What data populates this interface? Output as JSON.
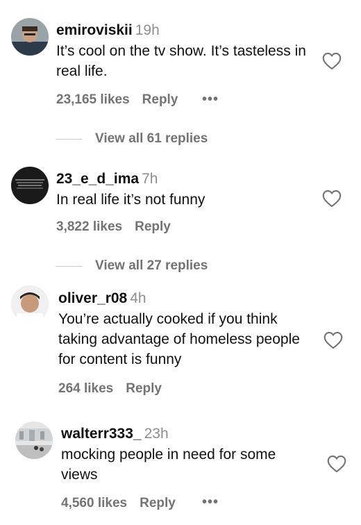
{
  "comments": [
    {
      "username": "emiroviskii",
      "time": "19h",
      "text": "It’s cool on the tv show. It’s tasteless in real life.",
      "likes": "23,165 likes",
      "reply": "Reply",
      "more": "•••"
    },
    {
      "username": "23_e_d_ima",
      "time": "7h",
      "text": "In real life it’s not funny",
      "likes": "3,822 likes",
      "reply": "Reply"
    },
    {
      "username": "oliver_r08",
      "time": "4h",
      "text": "You’re actually cooked if you think taking advantage of homeless people for content is funny",
      "likes": "264 likes",
      "reply": "Reply"
    },
    {
      "username": "walterr333_",
      "time": "23h",
      "text": "mocking people in need for some views",
      "likes": "4,560 likes",
      "reply": "Reply",
      "more": "•••"
    }
  ],
  "view_replies": [
    {
      "label": "View all 61 replies"
    },
    {
      "label": "View all 27 replies"
    }
  ],
  "icons": {
    "like": "heart-outline-icon",
    "more": "more-horizontal-icon"
  }
}
